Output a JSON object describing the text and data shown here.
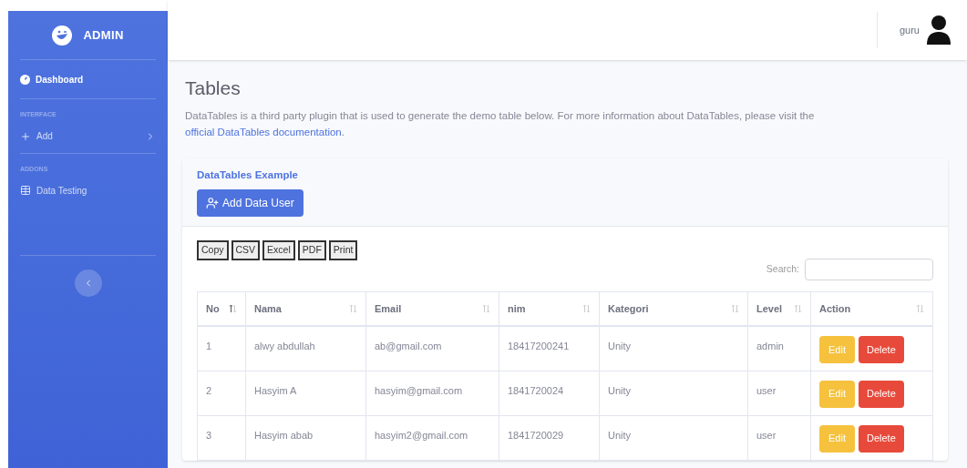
{
  "sidebar": {
    "brand": "ADMIN",
    "sections": [
      {
        "items": [
          {
            "label": "Dashboard",
            "kind": "dashboard",
            "selected": true
          }
        ]
      },
      {
        "heading": "INTERFACE",
        "items": [
          {
            "label": "Add",
            "kind": "add",
            "selected": false,
            "expanded": false
          }
        ]
      },
      {
        "heading": "ADDONS",
        "items": [
          {
            "label": "Data Testing",
            "kind": "table",
            "selected": false
          }
        ]
      }
    ]
  },
  "topbar": {
    "user_name": "guru"
  },
  "page": {
    "title": "Tables",
    "description": "DataTables is a third party plugin that is used to generate the demo table below. For more information about DataTables, please visit the ",
    "link": "official DataTables documentation",
    "after_link": "."
  },
  "card": {
    "title": "DataTables Example",
    "add_button": "Add Data User",
    "export_buttons": [
      "Copy",
      "CSV",
      "Excel",
      "PDF",
      "Print"
    ],
    "search_label": "Search:",
    "columns": [
      {
        "label": "No",
        "sorted": true
      },
      {
        "label": "Nama",
        "sorted": false
      },
      {
        "label": "Email",
        "sorted": false
      },
      {
        "label": "nim",
        "sorted": false
      },
      {
        "label": "Kategori",
        "sorted": false
      },
      {
        "label": "Level",
        "sorted": false
      },
      {
        "label": "Action",
        "sorted": false
      }
    ],
    "rows": [
      {
        "cells": [
          "1",
          "alwy abdullah",
          "ab@gmail.com",
          "18417200241",
          "Unity",
          "admin"
        ],
        "actions": [
          {
            "label": "Edit",
            "kind": "edit"
          },
          {
            "label": "Delete",
            "kind": "delete"
          }
        ]
      },
      {
        "cells": [
          "2",
          "Hasyim A",
          "hasyim@gmail.com",
          "1841720024",
          "Unity",
          "user"
        ],
        "actions": [
          {
            "label": "Edit",
            "kind": "edit"
          },
          {
            "label": "Delete",
            "kind": "delete"
          }
        ]
      },
      {
        "cells": [
          "3",
          "Hasyim abab",
          "hasyim2@gmail.com",
          "1841720029",
          "Unity",
          "user"
        ],
        "actions": [
          {
            "label": "Edit",
            "kind": "edit"
          },
          {
            "label": "Delete",
            "kind": "delete"
          }
        ]
      }
    ]
  }
}
